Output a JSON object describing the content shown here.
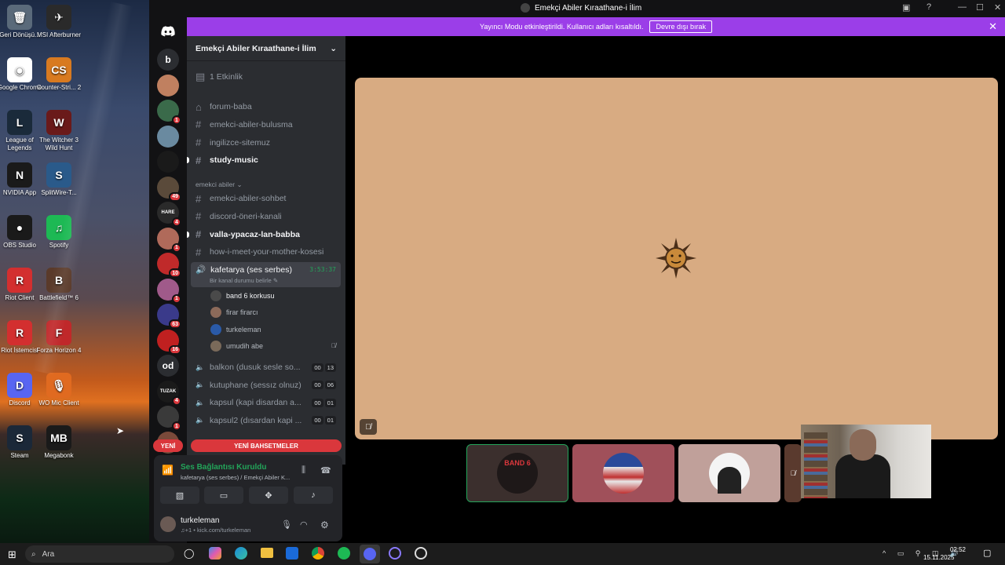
{
  "desktop": {
    "icons": [
      {
        "label": "Geri Dönüşü...",
        "glyph": "🗑"
      },
      {
        "label": "MSI Afterburner",
        "glyph": "✈"
      },
      {
        "label": "Google Chrome",
        "glyph": "◉"
      },
      {
        "label": "Counter-Stri... 2",
        "glyph": "CS"
      },
      {
        "label": "League of Legends",
        "glyph": "L"
      },
      {
        "label": "The Witcher 3 Wild Hunt",
        "glyph": "W"
      },
      {
        "label": "NVIDIA App",
        "glyph": "N"
      },
      {
        "label": "SplitWire-T...",
        "glyph": "S"
      },
      {
        "label": "OBS Studio",
        "glyph": "●"
      },
      {
        "label": "Spotify",
        "glyph": "♫"
      },
      {
        "label": "Riot Client",
        "glyph": "R"
      },
      {
        "label": "Battlefield™ 6",
        "glyph": "B"
      },
      {
        "label": "Riot İstemcisi",
        "glyph": "R"
      },
      {
        "label": "Forza Horizon 4",
        "glyph": "F"
      },
      {
        "label": "Discord",
        "glyph": "D"
      },
      {
        "label": "WO Mic Client",
        "glyph": "🎙"
      },
      {
        "label": "Steam",
        "glyph": "S"
      },
      {
        "label": "Megabonk",
        "glyph": "MB"
      }
    ]
  },
  "window": {
    "title": "Emekçi Abiler Kıraathane-i İlim",
    "controls": [
      "—",
      "☐",
      "✕"
    ]
  },
  "banner": {
    "text": "Yayıncı Modu etkinleştirildi. Kullanıcı adları kısaltıldı.",
    "button": "Devre dışı bırak",
    "close": "✕"
  },
  "servers": {
    "items": [
      {
        "label": "b",
        "badge": ""
      },
      {
        "label": "",
        "badge": ""
      },
      {
        "label": "",
        "badge": "1"
      },
      {
        "label": "",
        "badge": ""
      },
      {
        "label": "",
        "badge": ""
      },
      {
        "label": "",
        "badge": "49"
      },
      {
        "label": "HARE",
        "badge": "4"
      },
      {
        "label": "",
        "badge": "1"
      },
      {
        "label": "",
        "badge": "10"
      },
      {
        "label": "",
        "badge": "1"
      },
      {
        "label": "",
        "badge": "63"
      },
      {
        "label": "",
        "badge": "16"
      },
      {
        "label": "od",
        "badge": ""
      },
      {
        "label": "TUZAK",
        "badge": "4"
      },
      {
        "label": "",
        "badge": "1"
      },
      {
        "label": "",
        "badge": ""
      }
    ],
    "new_label": "YENİ"
  },
  "sidebar": {
    "server_name": "Emekçi Abiler Kıraathane-i İlim",
    "events": "1 Etkinlik",
    "channels_top": [
      {
        "name": "forum-baba",
        "unread": false
      },
      {
        "name": "emekci-abiler-bulusma",
        "unread": false
      },
      {
        "name": "ingilizce-sitemuz",
        "unread": false
      },
      {
        "name": "study-music",
        "unread": true
      }
    ],
    "category": "emekci abiler",
    "channels_cat": [
      {
        "name": "emekci-abiler-sohbet",
        "unread": false
      },
      {
        "name": "discord-öneri-kanali",
        "unread": false
      },
      {
        "name": "valla-ypacaz-lan-babba",
        "unread": true
      },
      {
        "name": "how-i-meet-your-mother-kosesi",
        "unread": false
      }
    ],
    "active_voice": {
      "name": "kafetarya (ses serbes)",
      "timer": "3:53:37",
      "status": "Bir kanal durumu belirle"
    },
    "voice_users": [
      {
        "name": "band 6 korkusu",
        "color": "#4a4a4a",
        "muted": false
      },
      {
        "name": "firar firarcı",
        "color": "#8c6a5a",
        "muted": false
      },
      {
        "name": "turkeleman",
        "color": "#2a5aa8",
        "muted": false
      },
      {
        "name": "umudih abe",
        "color": "#7a6a5a",
        "muted": true
      }
    ],
    "voice_channels": [
      {
        "name": "balkon (dusuk sesle so...",
        "c1": "00",
        "c2": "13"
      },
      {
        "name": "kutuphane (sessız olnuz)",
        "c1": "00",
        "c2": "06"
      },
      {
        "name": "kapsul (kapi disardan a...",
        "c1": "00",
        "c2": "01"
      },
      {
        "name": "kapsul2 (dısardan kapi ...",
        "c1": "00",
        "c2": "01"
      }
    ],
    "new_mentions": "YENİ BAHSETMELER"
  },
  "voice_panel": {
    "status": "Ses Bağlantısı Kuruldu",
    "channel": "kafetarya (ses serbes) / Emekçi Abiler K...",
    "user_name": "turkeleman",
    "user_status": "♫+1 • kick.com/turkeleman"
  },
  "stage": {
    "main_tile_color": "#d8ab82",
    "tiles": [
      {
        "label": "BAND 6",
        "bg": "#3b2f2d"
      },
      {
        "label": "",
        "bg": "#a0505a"
      },
      {
        "label": "",
        "bg": "#c0a09a"
      }
    ]
  },
  "taskbar": {
    "search": "Ara",
    "time": "02:52",
    "date": "15.11.2025"
  }
}
